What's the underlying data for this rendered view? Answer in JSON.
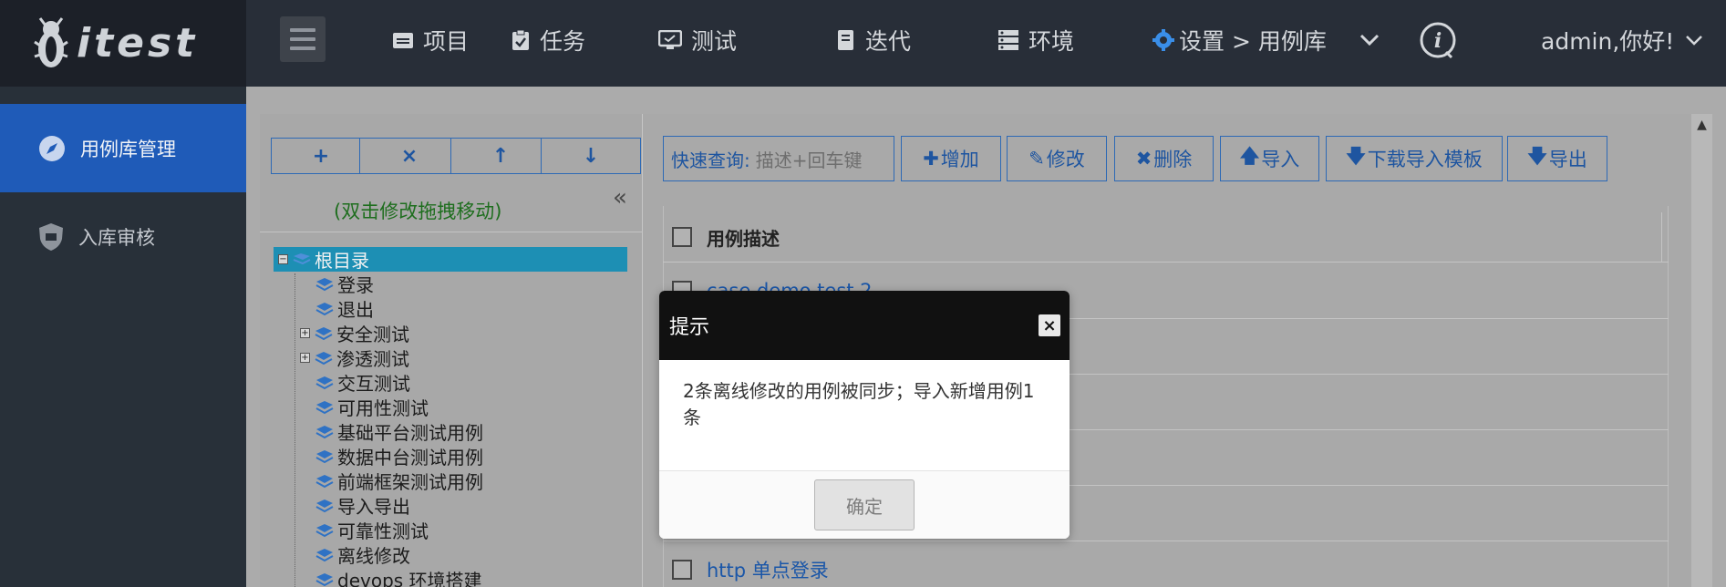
{
  "header": {
    "logo_text": "itest",
    "nav": [
      {
        "label": "项目",
        "icon": "folder-icon"
      },
      {
        "label": "任务",
        "icon": "clipboard-icon"
      },
      {
        "label": "测试",
        "icon": "monitor-icon"
      },
      {
        "label": "迭代",
        "icon": "book-icon"
      },
      {
        "label": "环境",
        "icon": "server-icon"
      }
    ],
    "settings_breadcrumb": "设置 > 用例库",
    "info_icon": "info-icon",
    "user_greeting": "admin,你好!"
  },
  "sidebar": {
    "items": [
      {
        "label": "用例库管理",
        "icon": "compass-icon",
        "active": true
      },
      {
        "label": "入库审核",
        "icon": "shield-icon",
        "active": false
      }
    ]
  },
  "tree_toolbar": {
    "buttons": [
      "+",
      "×",
      "↑",
      "↓"
    ],
    "hint": "(双击修改拖拽移动)",
    "collapse": "«"
  },
  "tree": {
    "root": "根目录",
    "nodes": [
      {
        "label": "登录",
        "expandable": false
      },
      {
        "label": "退出",
        "expandable": false
      },
      {
        "label": "安全测试",
        "expandable": true
      },
      {
        "label": "渗透测试",
        "expandable": true
      },
      {
        "label": "交互测试",
        "expandable": false
      },
      {
        "label": "可用性测试",
        "expandable": false
      },
      {
        "label": "基础平台测试用例",
        "expandable": false
      },
      {
        "label": "数据中台测试用例",
        "expandable": false
      },
      {
        "label": "前端框架测试用例",
        "expandable": false
      },
      {
        "label": "导入导出",
        "expandable": false
      },
      {
        "label": "可靠性测试",
        "expandable": false
      },
      {
        "label": "离线修改",
        "expandable": false
      },
      {
        "label": "devops 环境搭建",
        "expandable": false
      }
    ]
  },
  "case_toolbar": {
    "search_label": "快速查询:",
    "search_placeholder": "描述+回车键",
    "add": "增加",
    "edit": "修改",
    "delete": "删除",
    "import": "导入",
    "download_template": "下载导入模板",
    "export": "导出"
  },
  "table": {
    "header": "用例描述",
    "rows": [
      "case demo test 2",
      "http 单点登录"
    ]
  },
  "modal": {
    "title": "提示",
    "close": "×",
    "message": "2条离线修改的用例被同步；导入新增用例1条",
    "ok": "确定"
  },
  "colors": {
    "topbar": "#282e38",
    "sidebar_active": "#1f5bb8",
    "link": "#1a56a8",
    "hint": "#1e6e1e"
  }
}
